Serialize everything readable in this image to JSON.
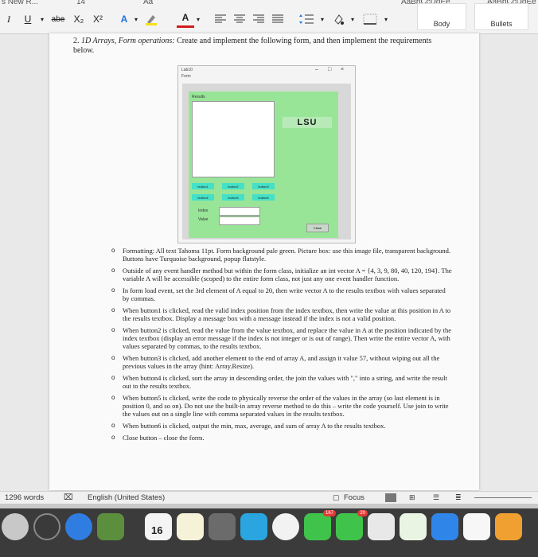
{
  "ribbon": {
    "top_fragments": [
      "s New R...",
      "14",
      "Aa",
      "AaBbCcDdEe",
      "AaBbCcDdEe"
    ],
    "format_buttons": [
      "I",
      "U",
      "abe",
      "X₂",
      "X²",
      "A",
      "A"
    ],
    "styles": [
      {
        "preview": "AaBbCcDdEe",
        "label": "Body"
      },
      {
        "preview": "AaBbCcDdEe",
        "label": "Bullets"
      }
    ]
  },
  "document": {
    "question_number": "2.",
    "question_title": "1D Arrays, Form operations:",
    "question_text": "Create and implement the following form, and then implement the requirements below.",
    "form": {
      "window_title": "Lab10",
      "form_name": "Form",
      "results_label": "Results",
      "picture_text": "LSU",
      "buttons": [
        "button1",
        "button2",
        "button3",
        "button4",
        "button5",
        "button6"
      ],
      "index_label": "Index",
      "value_label": "Value",
      "close_label": "Close"
    },
    "bullets": [
      {
        "lead": "",
        "text": "Formatting: All text Tahoma 11pt. Form background pale green. Picture box: use this image file, transparent background. Buttons have Turquoise background, popup flatstyle."
      },
      {
        "lead": "",
        "text": "Outside of any event handler method but within the form class, initialize an int vector A = {4, 3, 9, 80, 40, 120, 194}. The variable A will be accessible (scoped) to the entire form class, not just any one event handler function."
      },
      {
        "lead": "",
        "text": "In form load event, set the 3rd element of A equal to 20, then write vector A to the results textbox with values separated by commas."
      },
      {
        "lead": "",
        "text": "When button1 is clicked, read the valid index position from the index textbox, then write the value at this position in A to the results textbox. Display a message box with a message instead if the index is not a valid position."
      },
      {
        "lead": "",
        "text": "When button2 is clicked, read the value from the value textbox, and replace the value in A at the position indicated by the index textbox (display an error message if the index is not integer or is out of range). Then write the entire vector A, with values separated by commas, to the results textbox."
      },
      {
        "lead": "",
        "text": "When button3 is clicked, add another element to the end of array A, and assign it value 57, without wiping out all the previous values in the array (hint: Array.Resize)."
      },
      {
        "lead": "",
        "text": "When button4 is clicked, sort the array in descending order, the join the values with \",\" into a string, and write the result out to the results textbox."
      },
      {
        "lead": "",
        "text": "When button5 is clicked, write the code to physically reverse the order of the values in the array (so last element is in position 0, and so on). Do not use the built-in array reverse method to do this – write the code yourself. Use join to write the values out on a single line with comma separated values in the results textbox."
      },
      {
        "lead": "",
        "text": "When button6 is clicked, output the min, max, average, and sum of array A to the results textbox."
      },
      {
        "lead": "",
        "text": "Close button – close the form."
      }
    ]
  },
  "status": {
    "words": "1296 words",
    "language": "English (United States)",
    "focus": "Focus"
  },
  "dock": {
    "calendar_day": "16",
    "badge_1": "167",
    "badge_2": "20"
  },
  "colors": {
    "form_green": "#98e598",
    "button_turquoise": "#45e0c8",
    "link_blue": "#1a4fb0"
  }
}
